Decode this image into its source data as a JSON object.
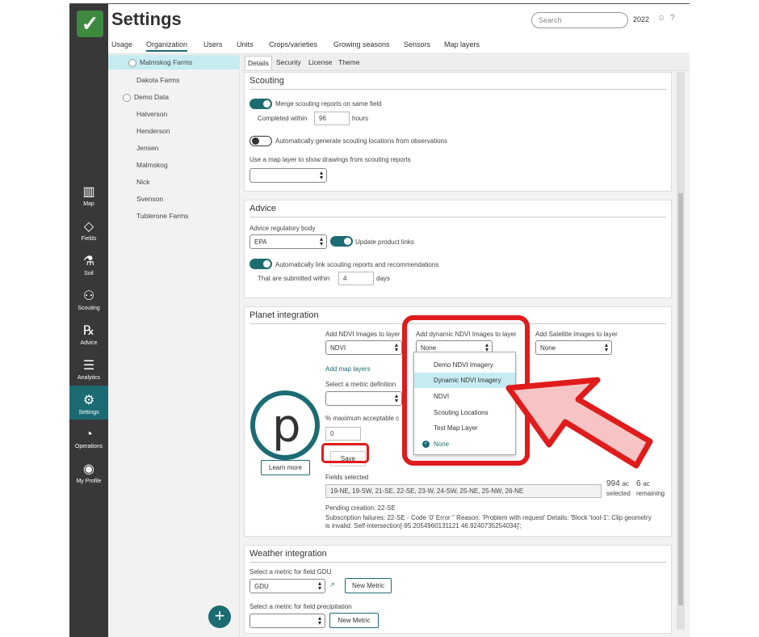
{
  "header": {
    "title": "Settings",
    "search_placeholder": "Search",
    "year": "2022"
  },
  "nav_tabs": [
    "Usage",
    "Organization",
    "Users",
    "Units",
    "Crops/varieties",
    "Growing seasons",
    "Sensors",
    "Map layers"
  ],
  "sidebar": {
    "items": [
      {
        "label": "Map",
        "icon": "map-icon"
      },
      {
        "label": "Fields",
        "icon": "fields-icon"
      },
      {
        "label": "Soil",
        "icon": "soil-icon"
      },
      {
        "label": "Scouting",
        "icon": "binoculars-icon"
      },
      {
        "label": "Advice",
        "icon": "clipboard-icon"
      },
      {
        "label": "Analytics",
        "icon": "analytics-icon"
      },
      {
        "label": "Settings",
        "icon": "gear-icon"
      },
      {
        "label": "Operations",
        "icon": "operations-icon"
      },
      {
        "label": "My Profile",
        "icon": "profile-icon"
      }
    ]
  },
  "farms": [
    "Malmskog Farms",
    "Dakota Farms",
    "Demo Data",
    "Halverson",
    "Henderson",
    "Jensen",
    "Malmskog",
    "Nick",
    "Svenson",
    "Tublerone Farms"
  ],
  "subtabs": [
    "Details",
    "Security",
    "License",
    "Theme"
  ],
  "scouting": {
    "title": "Scouting",
    "merge_label": "Merge scouting reports on same field",
    "completed_within": "Completed within",
    "completed_value": "96",
    "hours": "hours",
    "auto_generate_label": "Automatically generate scouting locations from observations",
    "map_layer_label": "Use a map layer to show drawings from scouting reports"
  },
  "advice": {
    "title": "Advice",
    "regulatory_label": "Advice regulatory body",
    "regulatory_value": "EPA",
    "update_links_label": "Update product links",
    "auto_link_label": "Automatically link scouting reports and recommendations",
    "submitted_within": "That are submitted within",
    "submitted_value": "4",
    "days": "days"
  },
  "planet": {
    "title": "Planet integration",
    "ndvi_label": "Add NDVI Images to layer",
    "ndvi_value": "NDVI",
    "dynamic_label": "Add dynamic NDVI Images to layer",
    "dynamic_value": "None",
    "satellite_label": "Add Satellite Images to layer",
    "satellite_value": "None",
    "add_map_layers": "Add map layers",
    "metric_label": "Select a metric definition",
    "max_cloud_label": "% maximum acceptable c",
    "max_cloud_value": "0",
    "save": "Save",
    "learn_more": "Learn more",
    "fields_selected_label": "Fields selected",
    "fields_selected_value": "19-NE, 19-SW, 21-SE, 22-SE, 23-W, 24-SW, 25-NE, 25-NW, 26-NE",
    "acres_selected": "994",
    "acres_selected_unit": "ac",
    "selected_word": "selected",
    "acres_remaining": "6",
    "acres_remaining_unit": "ac",
    "remaining_word": "remaining",
    "pending": "Pending creation: 22-SE",
    "failures": "Subscription failures: 22-SE - Code '0' Error '' Reason: 'Problem with request' Details: 'Block 'tool-1': Clip geometry is invalid: Self-intersection[-95.2054960131121 46.9240735254034]';",
    "logo_letter": "p",
    "dropdown_options": [
      "Demo NDVI Imagery",
      "Dynamic NDVI Imagery",
      "NDVI",
      "Scouting Locations",
      "Test Map Layer",
      "None"
    ]
  },
  "weather": {
    "title": "Weather integration",
    "gdu_label": "Select a metric for field GDU",
    "gdu_value": "GDU",
    "new_metric": "New Metric",
    "precip_label": "Select a metric for field precipitation",
    "new_metric_2": "New Metric"
  },
  "colors": {
    "accent": "#1b6b73",
    "highlight": "#e01b1b",
    "arrow_fill": "#f6c4c4"
  }
}
